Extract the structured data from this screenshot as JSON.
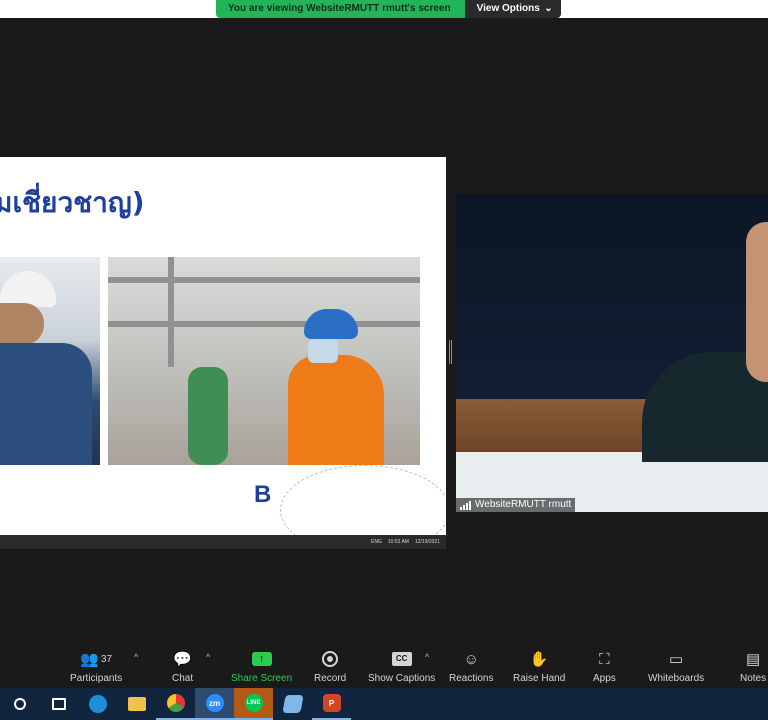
{
  "banner": {
    "viewing_text": "You are viewing WebsiteRMUTT rmutt's screen",
    "view_options_label": "View Options",
    "chevron": "⌄"
  },
  "shared_slide": {
    "title_fragment": "มเชี่ยวชาญ)",
    "logo_letter": "B",
    "taskbar_time": "10:53 AM",
    "taskbar_date": "12/19/2021",
    "taskbar_lang": "ENG"
  },
  "video_tile": {
    "participant_name": "WebsiteRMUTT rmutt"
  },
  "toolbar": {
    "participants": {
      "label": "Participants",
      "count": "37",
      "icon": "participants-icon"
    },
    "chat": {
      "label": "Chat",
      "icon": "chat-icon"
    },
    "share_screen": {
      "label": "Share Screen",
      "icon": "share-screen-icon",
      "glyph": "↑"
    },
    "record": {
      "label": "Record",
      "icon": "record-icon"
    },
    "show_captions": {
      "label": "Show Captions",
      "icon": "cc-icon",
      "glyph": "CC"
    },
    "reactions": {
      "label": "Reactions",
      "icon": "reactions-icon",
      "glyph": "☺"
    },
    "raise_hand": {
      "label": "Raise Hand",
      "icon": "hand-icon",
      "glyph": "✋"
    },
    "apps": {
      "label": "Apps",
      "icon": "apps-icon",
      "glyph": "⛶"
    },
    "whiteboards": {
      "label": "Whiteboards",
      "icon": "whiteboard-icon",
      "glyph": "▭"
    },
    "notes": {
      "label": "Notes",
      "icon": "notes-icon",
      "glyph": "▤"
    },
    "caret": "^"
  },
  "os_taskbar": {
    "zoom_label": "zm",
    "line_label": "LINE",
    "ppt_label": "P"
  },
  "colors": {
    "accent_green": "#23b45a",
    "slide_blue": "#1e3f9e",
    "taskbar_bg": "#12253e"
  }
}
